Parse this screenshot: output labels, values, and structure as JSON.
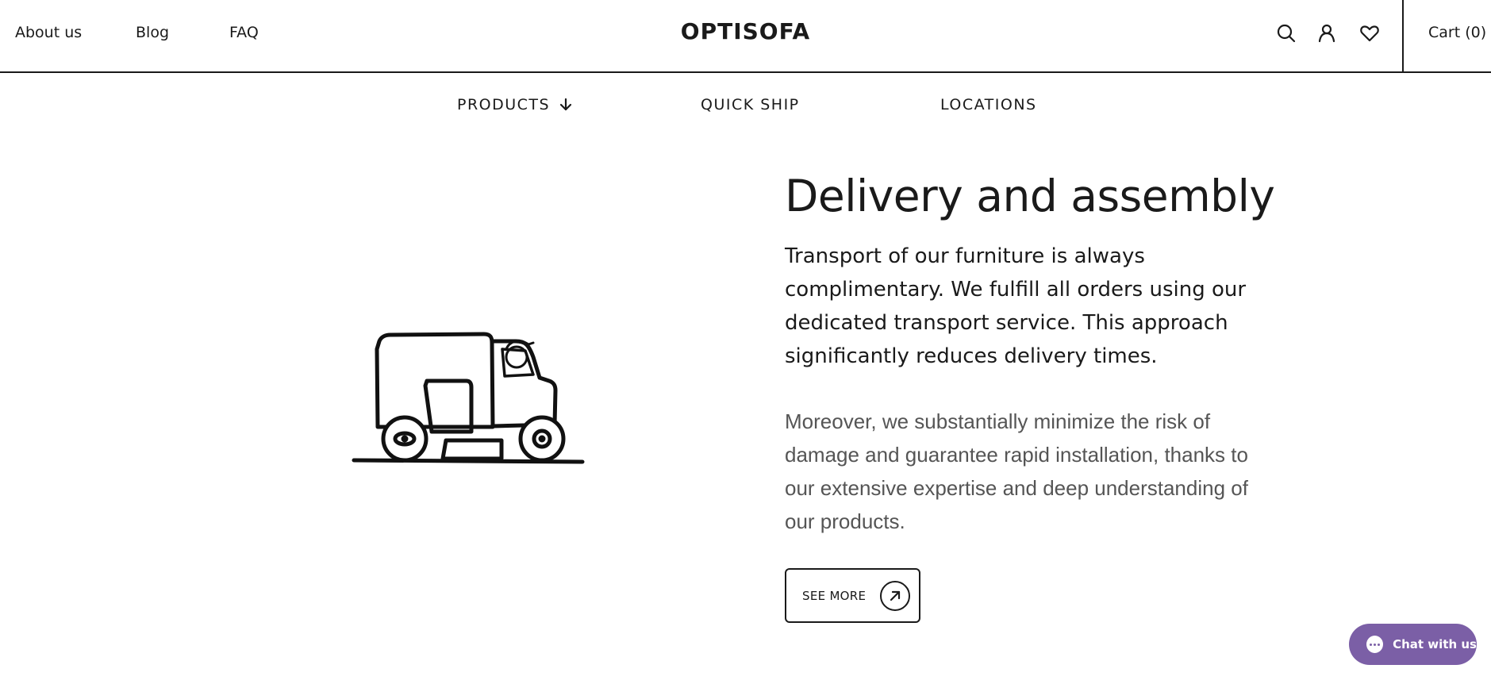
{
  "header": {
    "nav": [
      {
        "label": "About us"
      },
      {
        "label": "Blog"
      },
      {
        "label": "FAQ"
      }
    ],
    "logo": "OPTISOFA",
    "icons": [
      "search-icon",
      "account-icon",
      "heart-icon"
    ],
    "cart_label": "Cart (0)"
  },
  "subnav": {
    "items": [
      {
        "label": "PRODUCTS",
        "icon": "arrow-down-icon"
      },
      {
        "label": "QUICK SHIP"
      },
      {
        "label": "LOCATIONS"
      }
    ]
  },
  "main": {
    "title": "Delivery and assembly",
    "paragraph1": "Transport of our furniture is always complimentary. We fulfill all orders using our dedicated transport service. This approach significantly reduces delivery times.",
    "paragraph2": "Moreover, we substantially minimize the risk of damage and guarantee rapid installation, thanks to our extensive expertise and deep understanding of our products.",
    "button_label": "SEE MORE",
    "button_icon": "arrow-up-right-icon",
    "illustration": "delivery-truck-illustration"
  },
  "chat": {
    "label": "Chat with us",
    "color": "#7b5fa6"
  }
}
